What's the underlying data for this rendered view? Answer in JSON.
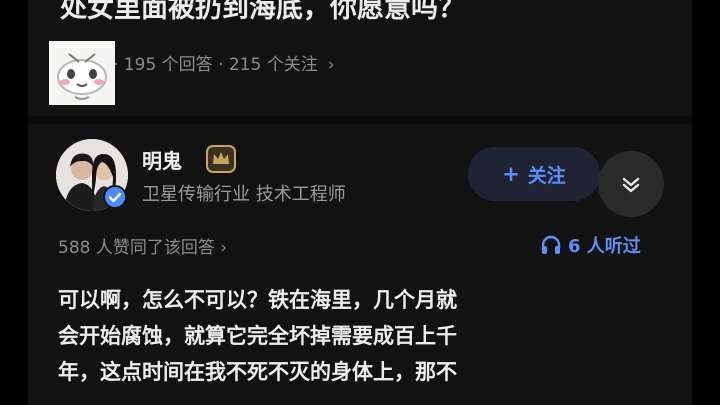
{
  "question": {
    "title": "处女里面被扔到海底，你愿意吗？",
    "stats": "· 195 个回答 · 215 个关注",
    "stats_chevron": "›",
    "thumbnail_icon": "sticker-thumbnail"
  },
  "author": {
    "name": "明鬼",
    "badge_icon": "crown-badge-icon",
    "bio": "卫星传输行业 技术工程师",
    "verified_icon": "verified-check-icon",
    "follow_label": "关注",
    "follow_plus": "+",
    "expand_icon": "chevron-down-icon"
  },
  "answer_meta": {
    "likes": "588 人赞同了该回答 ›",
    "listened": "6 人听过",
    "listen_icon": "headphones-icon"
  },
  "answer": {
    "lines": [
      "可以啊，怎么不可以？铁在海里，几个月就",
      "会开始腐蚀，就算它完全坏掉需要成百上千",
      "年，这点时间在我不死不灭的身体上，那不"
    ]
  },
  "colors": {
    "background": "#121212",
    "accent_blue": "#5B8FF9",
    "text_primary": "#EDEDED",
    "text_secondary": "#8C8C8C",
    "badge_gold": "#C9A45C"
  }
}
